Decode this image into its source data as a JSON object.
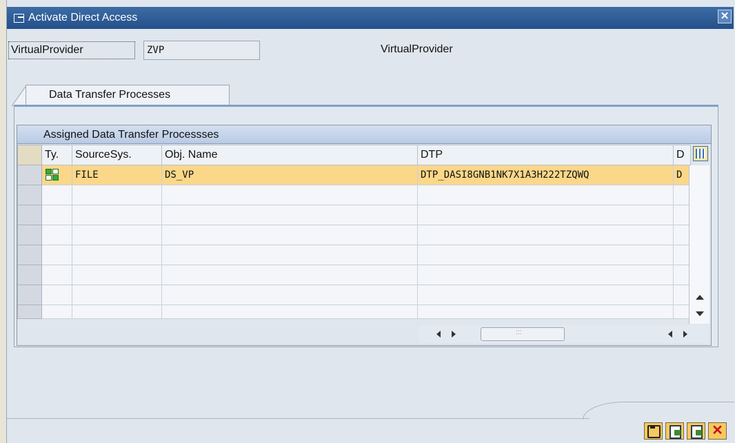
{
  "dialog": {
    "title": "Activate Direct Access"
  },
  "header": {
    "field_label": "VirtualProvider",
    "field_value": "ZVP",
    "field_description": "VirtualProvider"
  },
  "tabs": [
    {
      "label": "Data Transfer Processes"
    }
  ],
  "grid": {
    "title": "Assigned Data Transfer Processses",
    "columns": [
      "Ty.",
      "SourceSys.",
      "Obj. Name",
      "DTP",
      "D"
    ],
    "rows": [
      {
        "type_icon": "green-grid-icon",
        "source_sys": "FILE",
        "obj_name": "DS_VP",
        "dtp": "DTP_DASI8GNB1NK7X1A3H222TZQWQ",
        "d": "D"
      }
    ]
  },
  "footer": {
    "buttons": [
      "save-icon",
      "document-check-icon",
      "document-icon",
      "cancel-icon"
    ]
  },
  "colors": {
    "title_bar": "#2b5a94",
    "highlight_row": "#fbd78a",
    "button_bg": "#f6c95f"
  }
}
